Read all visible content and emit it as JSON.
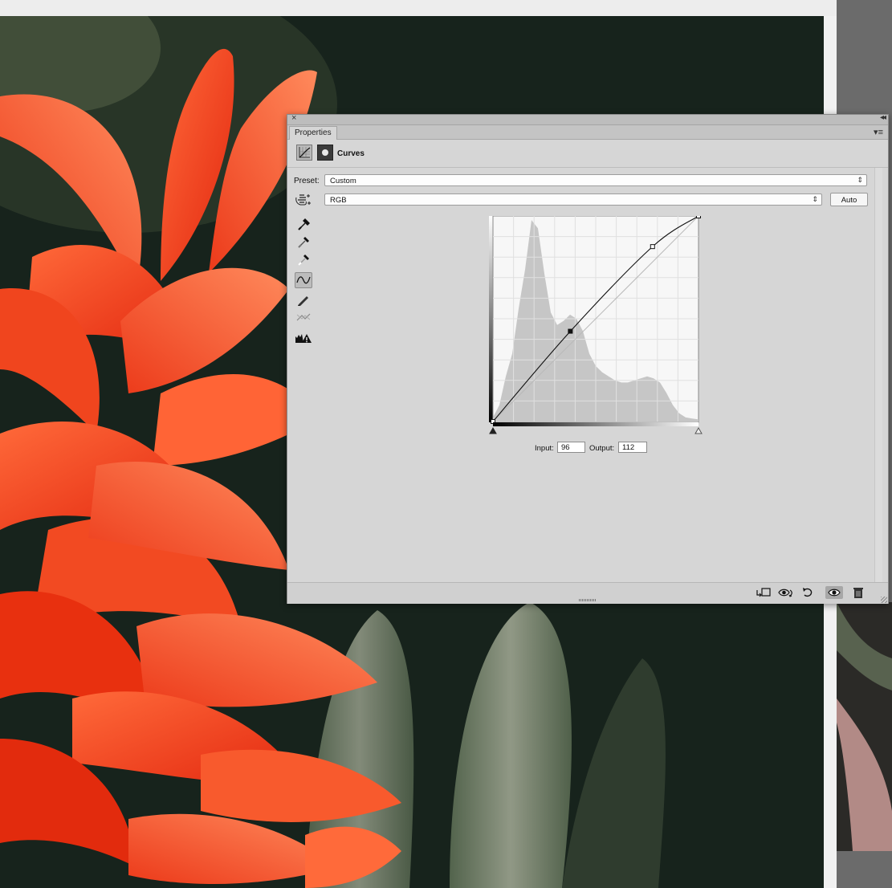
{
  "panel": {
    "tab_label": "Properties",
    "adjustment_title": "Curves"
  },
  "preset": {
    "label": "Preset:",
    "value": "Custom"
  },
  "channel": {
    "value": "RGB",
    "auto_label": "Auto"
  },
  "io": {
    "input_label": "Input:",
    "input_value": "96",
    "output_label": "Output:",
    "output_value": "112"
  },
  "curve": {
    "range_max": 255,
    "points": [
      {
        "input": 0,
        "output": 0
      },
      {
        "input": 96,
        "output": 112
      },
      {
        "input": 198,
        "output": 217
      },
      {
        "input": 255,
        "output": 255
      }
    ],
    "selected_point_index": 1
  },
  "histogram": {
    "levels": [
      0.02,
      0.08,
      0.22,
      0.33,
      0.55,
      0.74,
      0.98,
      0.94,
      0.72,
      0.53,
      0.47,
      0.49,
      0.52,
      0.5,
      0.44,
      0.33,
      0.27,
      0.24,
      0.22,
      0.2,
      0.19,
      0.19,
      0.2,
      0.21,
      0.22,
      0.21,
      0.19,
      0.14,
      0.08,
      0.04,
      0.02,
      0.015,
      0.01
    ]
  },
  "colors": {
    "panel_bg": "#d6d6d6",
    "histogram_fill": "#c6c6c6",
    "graph_bg": "#f7f7f7"
  },
  "icons": {
    "header": [
      "curves-adjustment-icon",
      "layer-mask-icon"
    ],
    "tools": [
      "target-adjust-icon",
      "black-point-eyedropper-icon",
      "gray-point-eyedropper-icon",
      "white-point-eyedropper-icon",
      "point-curve-icon",
      "pencil-curve-icon",
      "smooth-curve-icon",
      "clipping-warning-icon"
    ],
    "footer": [
      "clip-to-layer-icon",
      "view-previous-state-icon",
      "reset-icon",
      "visibility-eye-icon",
      "delete-icon"
    ]
  }
}
